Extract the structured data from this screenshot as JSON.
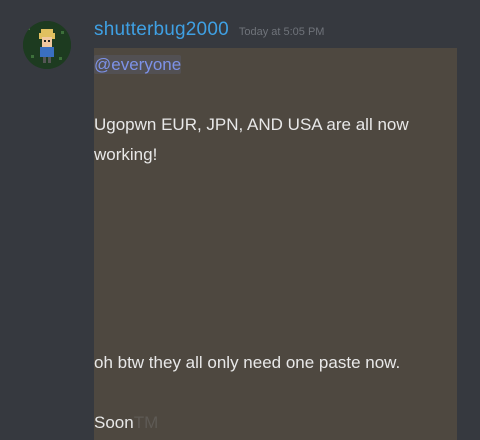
{
  "message": {
    "author": "shutterbug2000",
    "timestamp": "Today at 5:05 PM",
    "avatar_icon": "pixel-character-avatar",
    "mention": "@everyone",
    "line1": "Ugopwn EUR, JPN, AND USA are all now",
    "line2": "working!",
    "line3": "oh btw they all only need one paste now.",
    "line4_text": "Soon",
    "line4_suffix": "TM"
  },
  "colors": {
    "background": "#36393f",
    "username": "#3fa0e3",
    "mention": "#7d92e8",
    "highlight": "#4e4840"
  }
}
